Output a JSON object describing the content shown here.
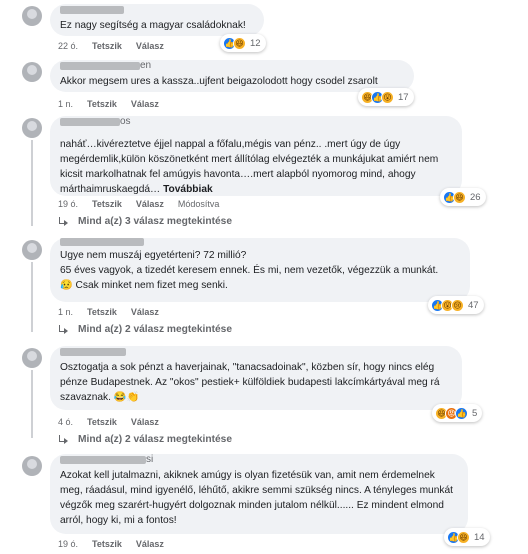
{
  "comments": [
    {
      "name_tail": "",
      "text": "Ez nagy segítség a magyar családoknak!",
      "time": "22 ó.",
      "like_label": "Tetszik",
      "reply_label": "Válasz",
      "reactions": [
        "like",
        "haha"
      ],
      "reaction_count": "12"
    },
    {
      "name_tail": "en",
      "text": "Akkor megsem ures a kassza..ujfent beigazolodott hogy csodel zsarolt",
      "time": "1 n.",
      "like_label": "Tetszik",
      "reply_label": "Válasz",
      "reactions": [
        "haha",
        "like",
        "wow"
      ],
      "reaction_count": "17"
    },
    {
      "name_tail": "os",
      "text": "naháť…kivéreztetve éjjel nappal a főfalu,mégis van pénz.. .mert úgy de úgy megérdemlik,külön köszönetként mert állítólag elvégezték a munkájukat amiért nem kicsit markolhatnak fel amúgyis havonta….mert alapból nyomorog mind, ahogy márthaimruskaegdá… ",
      "see_more": "Továbbiak",
      "time": "19 ó.",
      "like_label": "Tetszik",
      "reply_label": "Válasz",
      "edited_label": "Módosítva",
      "reactions": [
        "like",
        "haha"
      ],
      "reaction_count": "26",
      "replies_label": "Mind a(z) 3 válasz megtekintése"
    },
    {
      "name_tail": "",
      "text": "Ugye nem muszáj egyetérteni? 72 millió?\n65 éves vagyok, a tizedét keresem ennek. És mi, nem vezetők, végezzük a munkát.\n😥 Csak minket nem fizet meg senki.",
      "time": "1 n.",
      "like_label": "Tetszik",
      "reply_label": "Válasz",
      "reactions": [
        "like",
        "wow",
        "sad"
      ],
      "reaction_count": "47",
      "replies_label": "Mind a(z) 2 válasz megtekintése"
    },
    {
      "name_tail": "",
      "text": "Osztogatja a sok pénzt a haverjainak, \"tanacsadoinak\", közben sír, hogy nincs elég pénze Budapestnek. Az \"okos\" pestiek+ külföldiek budapesti lakcímkártyával meg rá szavaznak. 😂👏",
      "time": "4 ó.",
      "like_label": "Tetszik",
      "reply_label": "Válasz",
      "reactions": [
        "haha",
        "angry",
        "like"
      ],
      "reaction_count": "5",
      "replies_label": "Mind a(z) 2 válasz megtekintése"
    },
    {
      "name_tail": "si",
      "text": "Azokat kell jutalmazni, akiknek amúgy is olyan fizetésük van, amit nem érdemelnek meg, ráadásul, mind igyenélő, léhűtő, akikre semmi szükség nincs. A tényleges munkát végzők meg szarért-hugyért dolgoznak minden jutalom nélkül...... Ez mindent elmond arról, hogy ki, mi a fontos!",
      "time": "19 ó.",
      "like_label": "Tetszik",
      "reply_label": "Válasz",
      "reactions": [
        "like",
        "haha"
      ],
      "reaction_count": "14"
    }
  ],
  "reaction_glyphs": {
    "like": "👍",
    "haha": "😆",
    "wow": "😮",
    "sad": "😢",
    "angry": "😡"
  },
  "colors": {
    "bubble": "#f0f2f5",
    "meta_text": "#65676b",
    "like_blue": "#1877f2",
    "emoji_yellow": "#f7b125",
    "angry_orange": "#e9710f"
  }
}
